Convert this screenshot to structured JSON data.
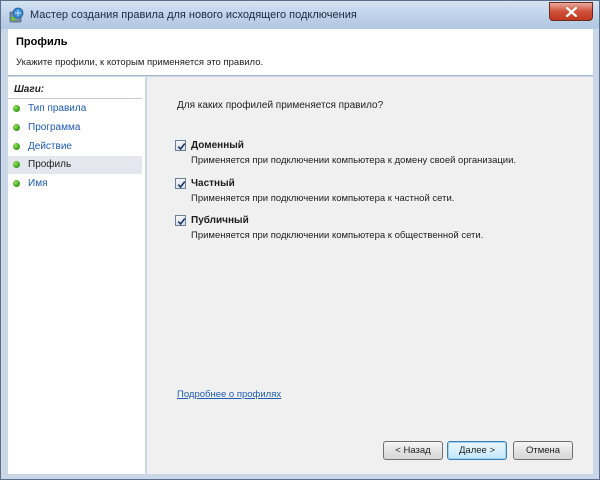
{
  "window": {
    "title": "Мастер создания правила для нового исходящего подключения"
  },
  "header": {
    "title": "Профиль",
    "subtitle": "Укажите профили, к которым применяется это правило."
  },
  "sidebar": {
    "steps_label": "Шаги:",
    "items": [
      {
        "label": "Тип правила",
        "active": false
      },
      {
        "label": "Программа",
        "active": false
      },
      {
        "label": "Действие",
        "active": false
      },
      {
        "label": "Профиль",
        "active": true
      },
      {
        "label": "Имя",
        "active": false
      }
    ]
  },
  "main": {
    "question": "Для каких профилей применяется правило?",
    "options": [
      {
        "label": "Доменный",
        "checked": true,
        "description": "Применяется при подключении компьютера к домену своей организации."
      },
      {
        "label": "Частный",
        "checked": true,
        "description": "Применяется при подключении компьютера к частной сети."
      },
      {
        "label": "Публичный",
        "checked": true,
        "description": "Применяется при подключении компьютера к общественной сети."
      }
    ],
    "link": "Подробнее о профилях"
  },
  "buttons": {
    "back": "< Назад",
    "next": "Далее >",
    "cancel": "Отмена"
  },
  "icons": {
    "title": "firewall-wizard-icon",
    "close": "close-icon",
    "step_bullet": "green-dot-icon",
    "checkbox": "checkmark-icon"
  },
  "colors": {
    "link": "#1f5bb5",
    "step_dot": "#2f9a16",
    "close_button": "#c1381f"
  }
}
